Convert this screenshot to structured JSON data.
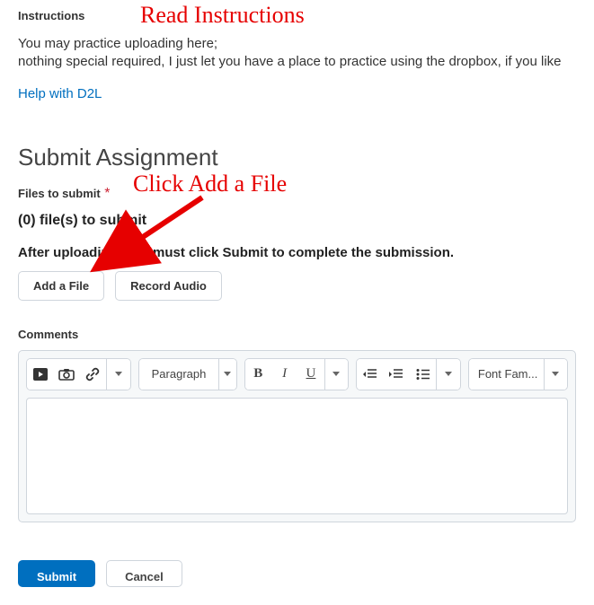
{
  "instructions": {
    "label": "Instructions",
    "line1": "You may practice uploading here;",
    "line2": "nothing special required, I just let you have a place to practice using the dropbox, if you like",
    "help_link": "Help with D2L"
  },
  "submit": {
    "heading": "Submit Assignment",
    "files_label": "Files to submit",
    "required_mark": "*",
    "file_count_text": "(0) file(s) to submit",
    "note": "After uploading, you must click Submit to complete the submission.",
    "add_file_label": "Add a File",
    "record_audio_label": "Record Audio"
  },
  "editor": {
    "comments_label": "Comments",
    "paragraph_label": "Paragraph",
    "bold": "B",
    "italic": "I",
    "underline": "U",
    "font_label": "Font Fam..."
  },
  "footer": {
    "submit_label": "Submit",
    "cancel_label": "Cancel"
  },
  "annotations": {
    "read_instructions": "Read Instructions",
    "click_add_file": "Click Add a File"
  }
}
